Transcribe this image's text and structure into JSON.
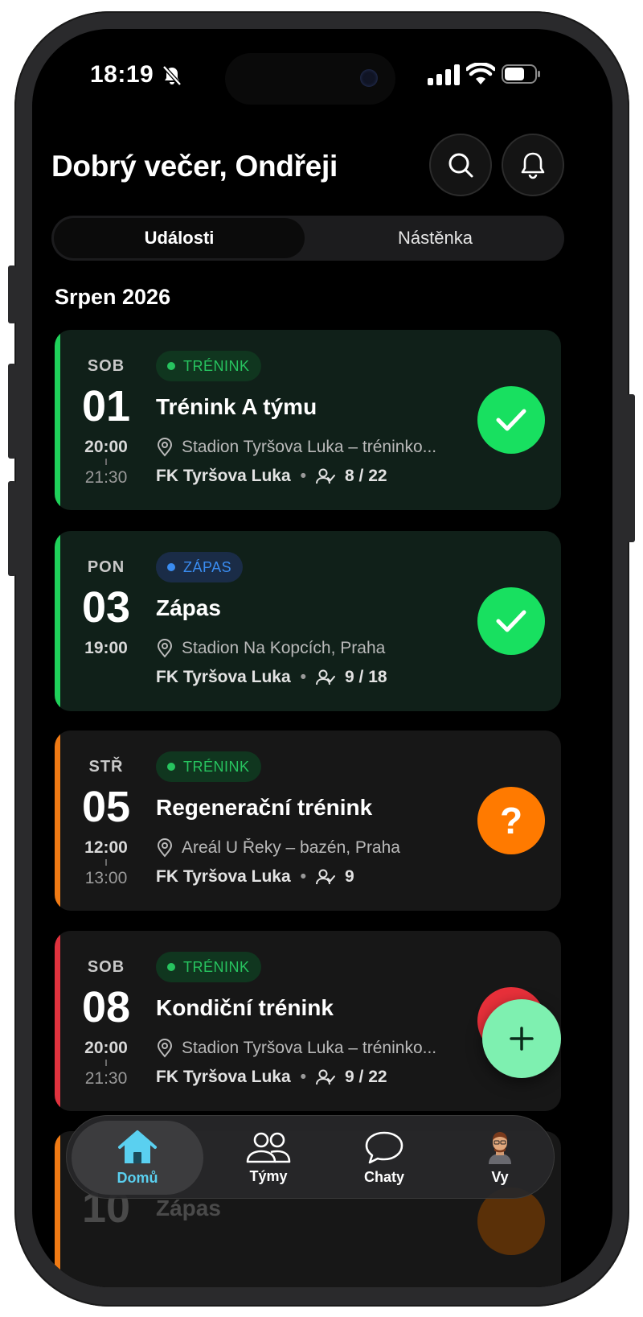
{
  "status_bar": {
    "time": "18:19"
  },
  "header": {
    "greeting": "Dobrý večer, Ondřeji"
  },
  "tabs": [
    {
      "label": "Události",
      "active": true
    },
    {
      "label": "Nástěnka",
      "active": false
    }
  ],
  "month": "Srpen 2026",
  "events": [
    {
      "day": "SOB",
      "date": "01",
      "start": "20:00",
      "end": "21:30",
      "badge": "TRÉNINK",
      "badge_type": "training",
      "title": "Trénink A týmu",
      "location": "Stadion Tyršova Luka – tréninko...",
      "team": "FK Tyršova Luka",
      "attendance": "8 / 22",
      "response": "accepted",
      "stripe_color": "#1fd15a"
    },
    {
      "day": "PON",
      "date": "03",
      "start": "19:00",
      "end": "",
      "badge": "ZÁPAS",
      "badge_type": "match",
      "title": "Zápas",
      "location": "Stadion Na Kopcích, Praha",
      "team": "FK Tyršova Luka",
      "attendance": "9 / 18",
      "response": "accepted",
      "stripe_color": "#1fd15a"
    },
    {
      "day": "STŘ",
      "date": "05",
      "start": "12:00",
      "end": "13:00",
      "badge": "TRÉNINK",
      "badge_type": "training",
      "title": "Regenerační trénink",
      "location": "Areál U Řeky – bazén, Praha",
      "team": "FK Tyršova Luka",
      "attendance": "9",
      "response": "pending",
      "response_symbol": "?",
      "stripe_color": "#f07a14"
    },
    {
      "day": "SOB",
      "date": "08",
      "start": "20:00",
      "end": "21:30",
      "badge": "TRÉNINK",
      "badge_type": "training",
      "title": "Kondiční trénink",
      "location": "Stadion Tyršova Luka – tréninko...",
      "team": "FK Tyršova Luka",
      "attendance": "9 / 22",
      "response": "declined",
      "stripe_color": "#e0323e"
    }
  ],
  "peek_event": {
    "date": "10",
    "title": "Zápas"
  },
  "nav": [
    {
      "label": "Domů",
      "icon": "home-icon",
      "active": true
    },
    {
      "label": "Týmy",
      "icon": "teams-icon",
      "active": false
    },
    {
      "label": "Chaty",
      "icon": "chat-icon",
      "active": false
    },
    {
      "label": "Vy",
      "icon": "avatar-icon",
      "active": false
    }
  ],
  "colors": {
    "accepted": "#18e060",
    "pending": "#ff7a00",
    "declined": "#e8303a",
    "fab": "#7ef0b0",
    "nav_active": "#5ad0f0"
  }
}
